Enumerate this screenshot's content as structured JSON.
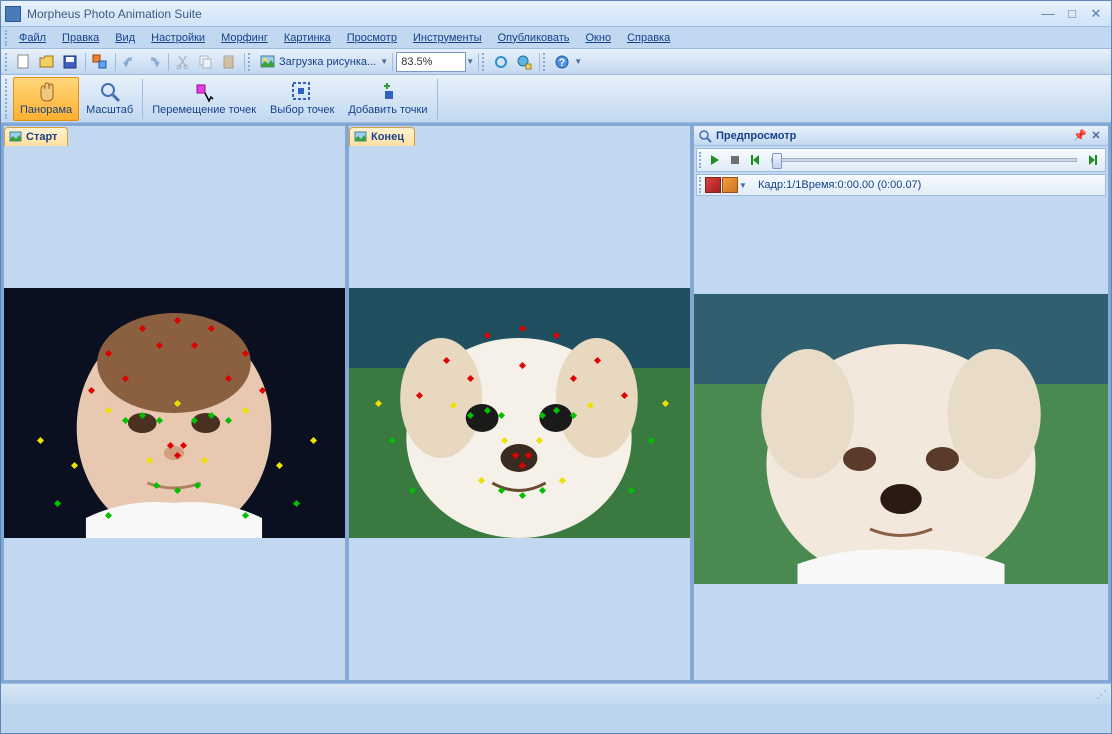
{
  "title": "Morpheus Photo Animation Suite",
  "menu": {
    "file": "Файл",
    "edit": "Правка",
    "view": "Вид",
    "settings": "Настройки",
    "morphing": "Морфинг",
    "picture": "Картинка",
    "preview": "Просмотр",
    "tools": "Инструменты",
    "publish": "Опубликовать",
    "window": "Окно",
    "help": "Справка"
  },
  "toolbar1": {
    "load_image": "Загрузка рисунка...",
    "zoom_value": "83.5%"
  },
  "toolbar2": {
    "panorama": "Панорама",
    "scale": "Масштаб",
    "move_points": "Перемещение точек",
    "select_points": "Выбор точек",
    "add_points": "Добавить точки"
  },
  "panels": {
    "start": "Старт",
    "end": "Конец",
    "preview": "Предпросмотр"
  },
  "preview_status": {
    "frame_time": "Кадр:1/1Время:0:00.00 (0:00.07)"
  },
  "colors": {
    "accent": "#ffb030",
    "panel_bg": "#c2d8f0",
    "text": "#15428b"
  }
}
